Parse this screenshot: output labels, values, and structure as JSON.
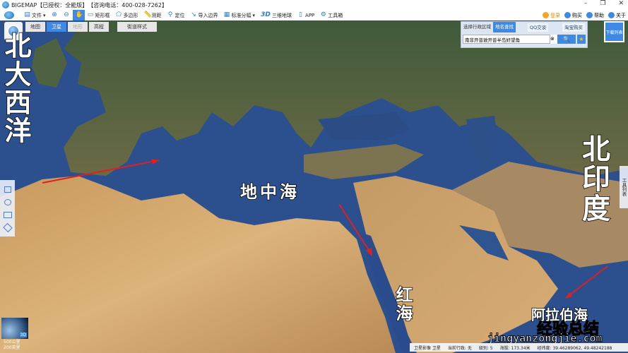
{
  "title": {
    "app": "BIGEMAP",
    "license": "【已授权：全能版】",
    "phone": "【咨询电话：400-028-7262】"
  },
  "window": {
    "minimize": "–",
    "restore": "❐",
    "close": "✕"
  },
  "toolbar": [
    {
      "label": "文件",
      "icon": "folder-icon",
      "glyph": "▤",
      "dropdown": true
    },
    {
      "label": "",
      "icon": "zoom-in-icon",
      "glyph": "⊕"
    },
    {
      "label": "",
      "icon": "zoom-out-icon",
      "glyph": "⊖"
    },
    {
      "label": "",
      "icon": "hand-pan-icon",
      "glyph": "✋",
      "active": true
    },
    {
      "label": "矩形框",
      "icon": "rectangle-select-icon",
      "glyph": "▭"
    },
    {
      "label": "多边形",
      "icon": "polygon-icon",
      "glyph": "⬠"
    },
    {
      "label": "测距",
      "icon": "ruler-icon",
      "glyph": "📏"
    },
    {
      "label": "定位",
      "icon": "location-pin-icon",
      "glyph": "⚲"
    },
    {
      "label": "导入边界",
      "icon": "import-boundary-icon",
      "glyph": "↘"
    },
    {
      "label": "标准分幅",
      "icon": "grid-icon",
      "glyph": "▦",
      "dropdown": true
    },
    {
      "label": "三维地球",
      "icon": "3d-icon",
      "glyph": "3D"
    },
    {
      "label": "APP",
      "icon": "phone-icon",
      "glyph": "▯"
    },
    {
      "label": "工具箱",
      "icon": "gear-icon",
      "glyph": "⚙"
    }
  ],
  "right_tools": [
    {
      "label": "登录",
      "color": "#f5a623"
    },
    {
      "label": "购买",
      "color": "#3d8ae6"
    },
    {
      "label": "帮助",
      "color": "#3d8ae6"
    },
    {
      "label": "关于",
      "color": "#3d8ae6"
    }
  ],
  "map_tabs": [
    {
      "label": "地图"
    },
    {
      "label": "卫星",
      "selected": true
    },
    {
      "label": "地形",
      "disabled": true
    },
    {
      "label": "高程"
    },
    {
      "label": "街道样式"
    }
  ],
  "search_panel": {
    "tab1": "选择行政区域",
    "tab2": "地名查找",
    "qq": "QQ交谈",
    "taobao": "淘宝购买",
    "input_value": "南非开普敦开普半岛好望角",
    "search_glyph": "🔍",
    "star_glyph": "★",
    "clear_glyph": "⊗"
  },
  "download_button": "下载列表",
  "side_tab": "工具列表",
  "minimap": {
    "label": "3D"
  },
  "scale": {
    "a": "500公里",
    "b": "200英里"
  },
  "status": {
    "source": "卫星影像 卫星",
    "region": "当前行政: 无",
    "level": "级别: 5",
    "altitude": "海拔: 173.34米",
    "coords": "经纬度: 39.46289062, 49.48242188"
  },
  "annotations": {
    "north_atlantic": "北大西洋",
    "mediterranean": "地中海",
    "red_sea": "红海",
    "north_indian": "北印度",
    "arabian_sea": "阿拉伯海"
  },
  "watermark": {
    "cn": "经验总结",
    "url": "jingyanzongjie.com"
  },
  "colors": {
    "accent": "#3d8ae6",
    "sea": "#2c4f8e",
    "land_green": "#4d5e3a",
    "desert": "#cfa46a",
    "arrow": "#e02020"
  }
}
